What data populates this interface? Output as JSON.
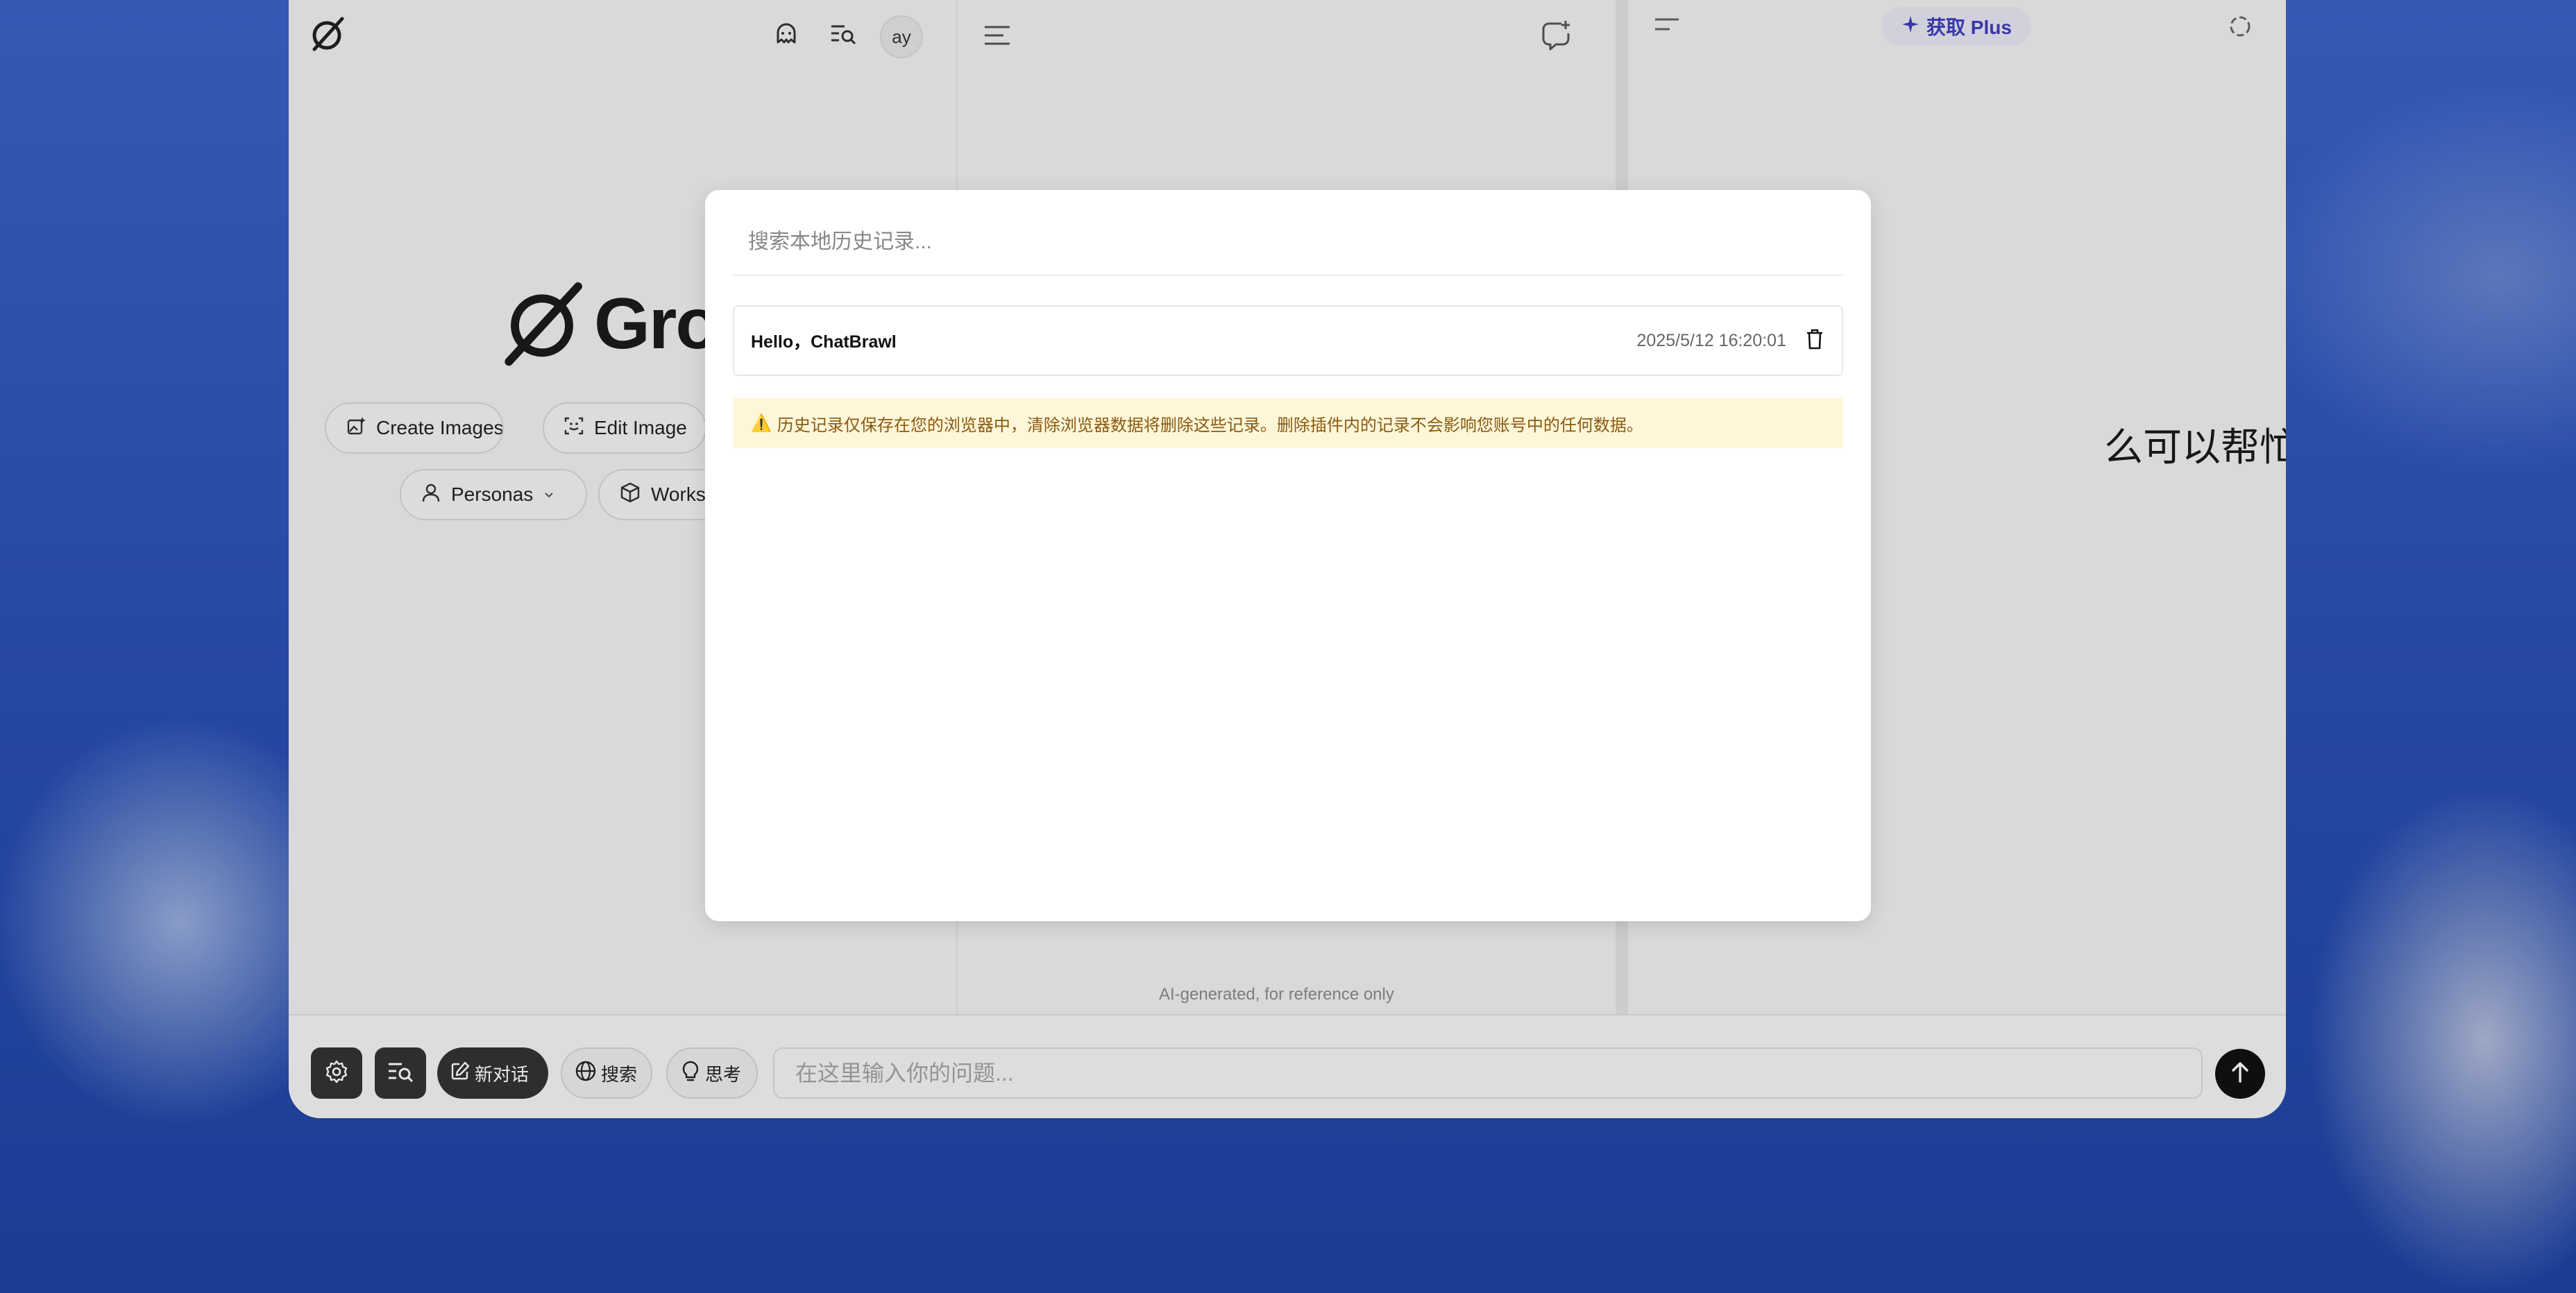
{
  "left_panel": {
    "brand_text": "Grok",
    "avatar_initials": "ay",
    "pills": [
      {
        "label": "Create Images",
        "icon": "image-sparkle-icon"
      },
      {
        "label": "Edit Image",
        "icon": "scan-edit-icon"
      },
      {
        "label": "Personas",
        "icon": "person-icon"
      },
      {
        "label": "Workspaces",
        "icon": "cube-icon"
      }
    ]
  },
  "right_panel": {
    "plus_label": "获取 Plus",
    "greeting_fragment": "么可以帮忙的?"
  },
  "middle_panel": {
    "disclaimer": "AI-generated, for reference only"
  },
  "bottom_bar": {
    "new_chat_label": "新对话",
    "search_label": "搜索",
    "think_label": "思考",
    "input_placeholder": "在这里输入你的问题..."
  },
  "modal": {
    "search_placeholder": "搜索本地历史记录...",
    "items": [
      {
        "title": "Hello，ChatBrawl",
        "time": "2025/5/12 16:20:01"
      }
    ],
    "warning": "历史记录仅保存在您的浏览器中，清除浏览器数据将删除这些记录。删除插件内的记录不会影响您账号中的任何数据。",
    "warning_icon": "⚠️"
  }
}
